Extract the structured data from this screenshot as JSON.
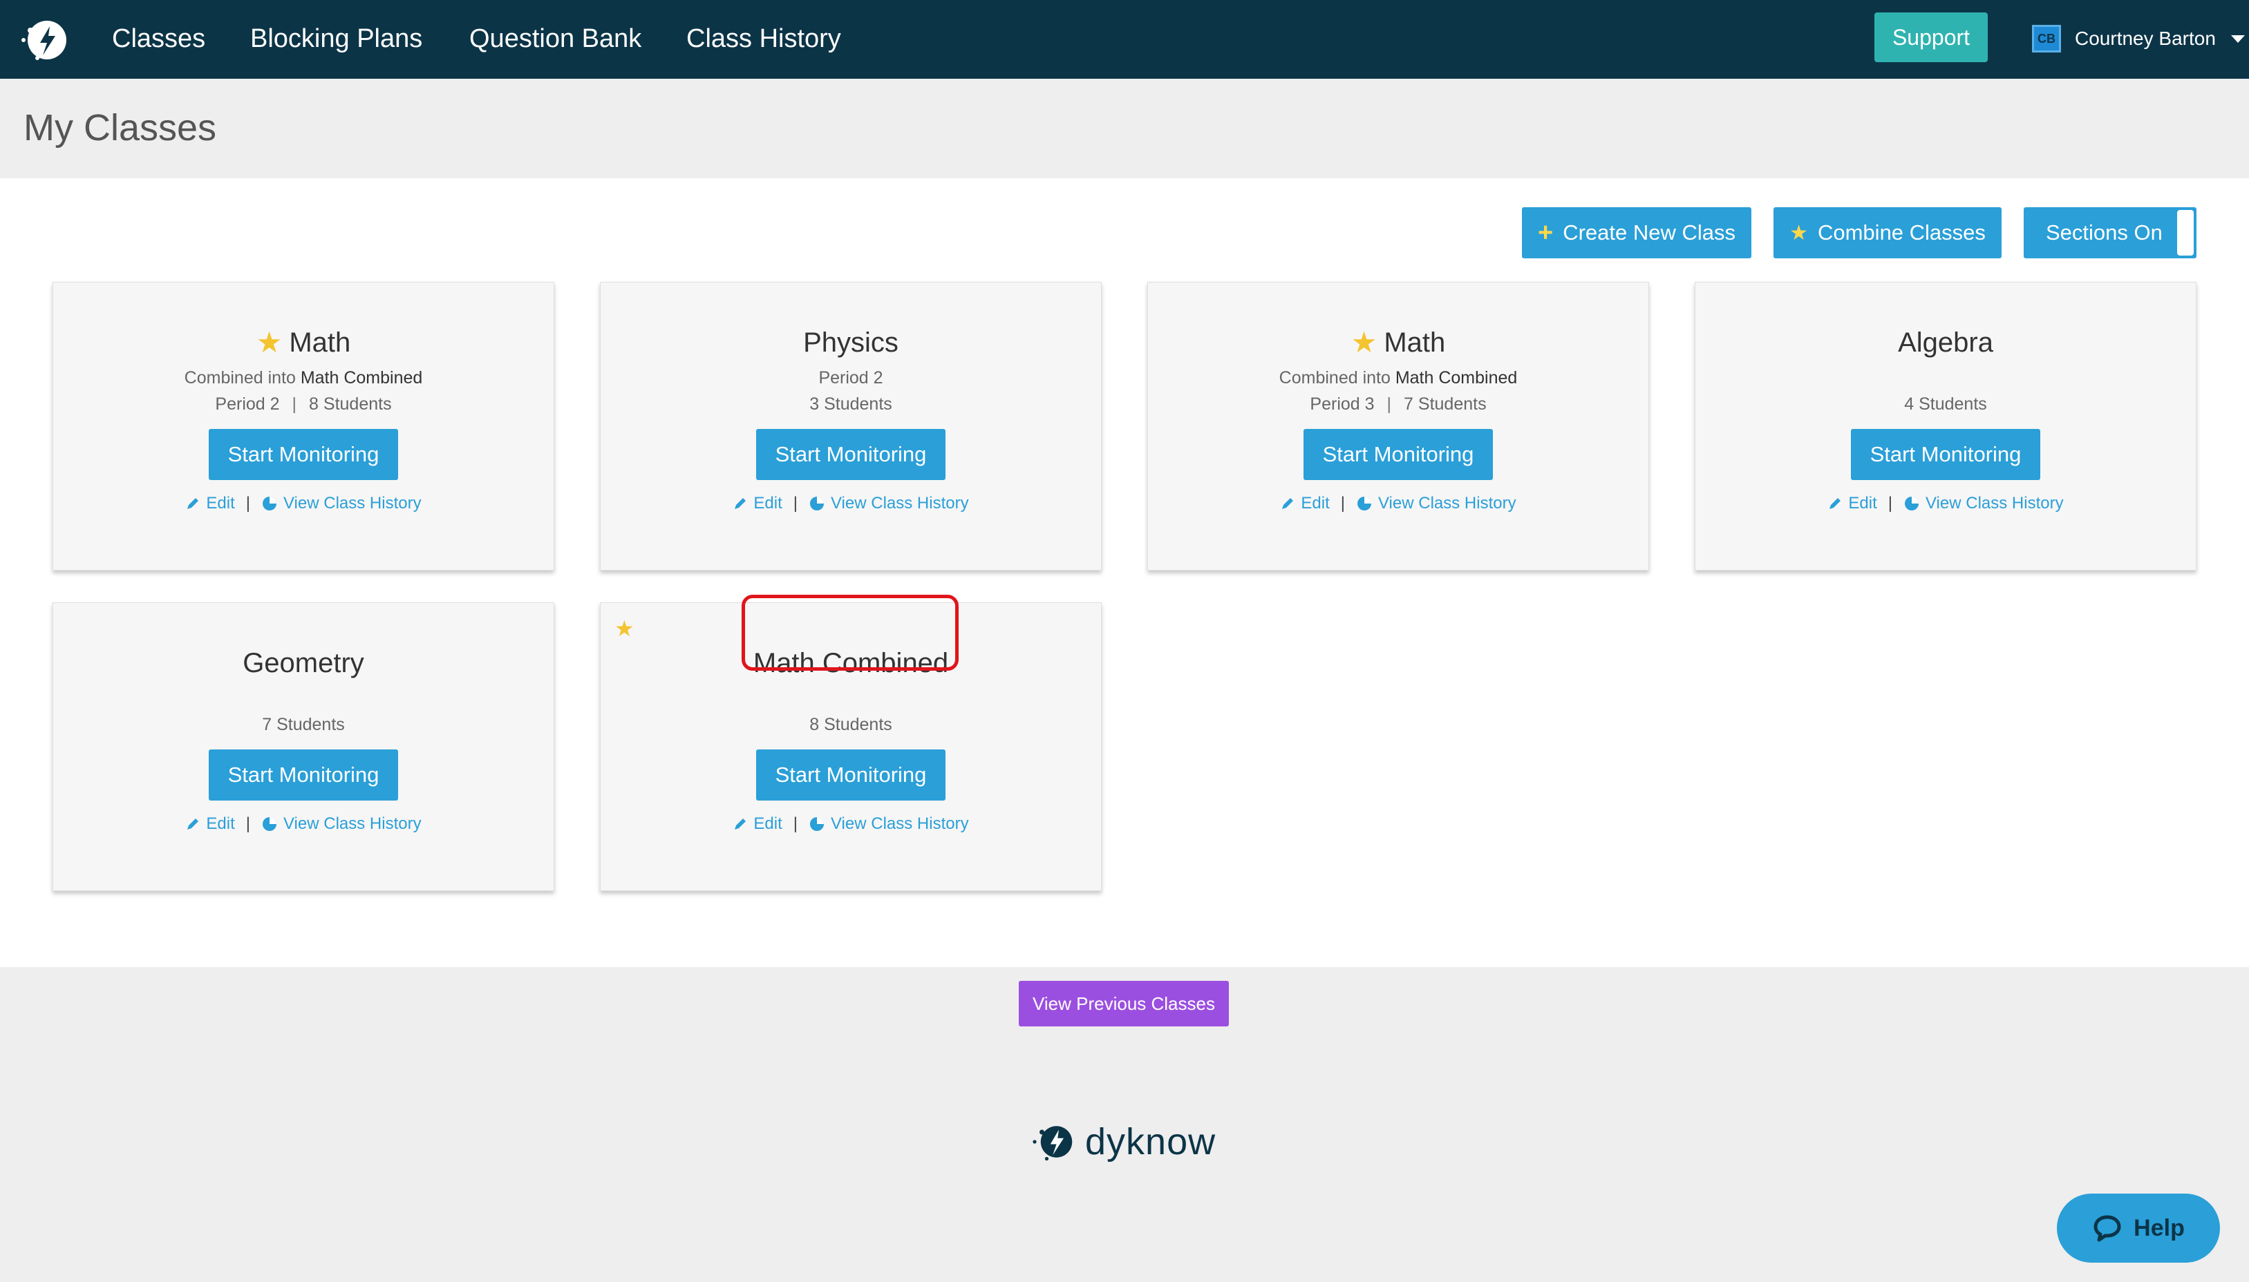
{
  "nav": {
    "links": [
      "Classes",
      "Blocking Plans",
      "Question Bank",
      "Class History"
    ],
    "support_label": "Support",
    "user": {
      "initials": "CB",
      "name": "Courtney Barton"
    }
  },
  "page": {
    "title": "My Classes"
  },
  "toolbar": {
    "create_label": "Create New Class",
    "combine_label": "Combine Classes",
    "sections_label": "Sections On"
  },
  "cards": [
    {
      "title": "Math",
      "starred": true,
      "combined_prefix": "Combined into ",
      "combined_target": "Math Combined",
      "period": "Period 2",
      "students": "8 Students",
      "button": "Start Monitoring",
      "edit": "Edit",
      "history": "View Class History"
    },
    {
      "title": "Physics",
      "starred": false,
      "period": "Period 2",
      "students": "3 Students",
      "button": "Start Monitoring",
      "edit": "Edit",
      "history": "View Class History"
    },
    {
      "title": "Math",
      "starred": true,
      "combined_prefix": "Combined into ",
      "combined_target": "Math Combined",
      "period": "Period 3",
      "students": "7 Students",
      "button": "Start Monitoring",
      "edit": "Edit",
      "history": "View Class History"
    },
    {
      "title": "Algebra",
      "starred": false,
      "students": "4 Students",
      "button": "Start Monitoring",
      "edit": "Edit",
      "history": "View Class History"
    },
    {
      "title": "Geometry",
      "starred": false,
      "students": "7 Students",
      "button": "Start Monitoring",
      "edit": "Edit",
      "history": "View Class History"
    },
    {
      "title": "Math Combined",
      "starred": true,
      "students": "8 Students",
      "button": "Start Monitoring",
      "edit": "Edit",
      "history": "View Class History"
    }
  ],
  "footer": {
    "previous_label": "View Previous Classes",
    "logo_text": "dyknow",
    "help_label": "Help"
  },
  "colors": {
    "nav_bg": "#0c3447",
    "accent": "#2a9fd8",
    "support": "#2fb3b0",
    "previous": "#9b4fe0",
    "star": "#f4c430",
    "highlight": "#e0151b"
  },
  "icons": [
    "dyknow-logo-icon",
    "star-icon",
    "plus-icon",
    "pencil-icon",
    "history-icon",
    "chat-bubble-icon",
    "caret-down-icon"
  ]
}
